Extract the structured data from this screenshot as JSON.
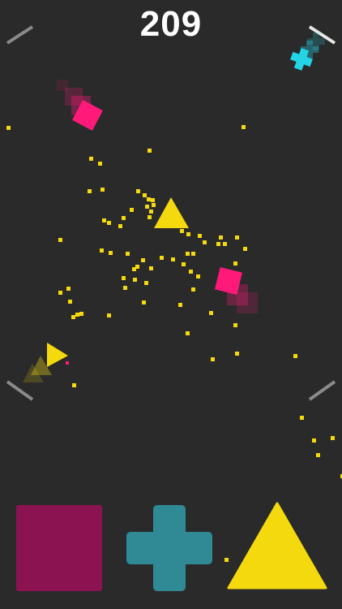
{
  "hud": {
    "score": "209"
  },
  "colors": {
    "background": "#2a2a2a",
    "magenta": "#ff1a7a",
    "magenta_dim": "#8c1352",
    "cyan": "#23d3e6",
    "teal_button": "#2f8a96",
    "yellow": "#f5d90f",
    "wall_marker": "#8a8a8a",
    "score_text": "#ffffff"
  },
  "controls": [
    {
      "shape": "square",
      "icon": "square-shape-icon",
      "color": "#8c1352"
    },
    {
      "shape": "cross",
      "icon": "cross-shape-icon",
      "color": "#2f8a96"
    },
    {
      "shape": "triangle",
      "icon": "triangle-shape-icon",
      "color": "#f5d90f"
    }
  ],
  "play_objects": [
    {
      "kind": "square",
      "color": "#ff1a7a",
      "trail": true
    },
    {
      "kind": "square",
      "color": "#ff1a7a",
      "trail": true
    },
    {
      "kind": "cross",
      "color": "#23d3e6",
      "trail": true
    },
    {
      "kind": "triangle",
      "color": "#f5d90f",
      "trail": false
    },
    {
      "kind": "triangle",
      "color": "#f5d90f",
      "trail": true
    }
  ]
}
